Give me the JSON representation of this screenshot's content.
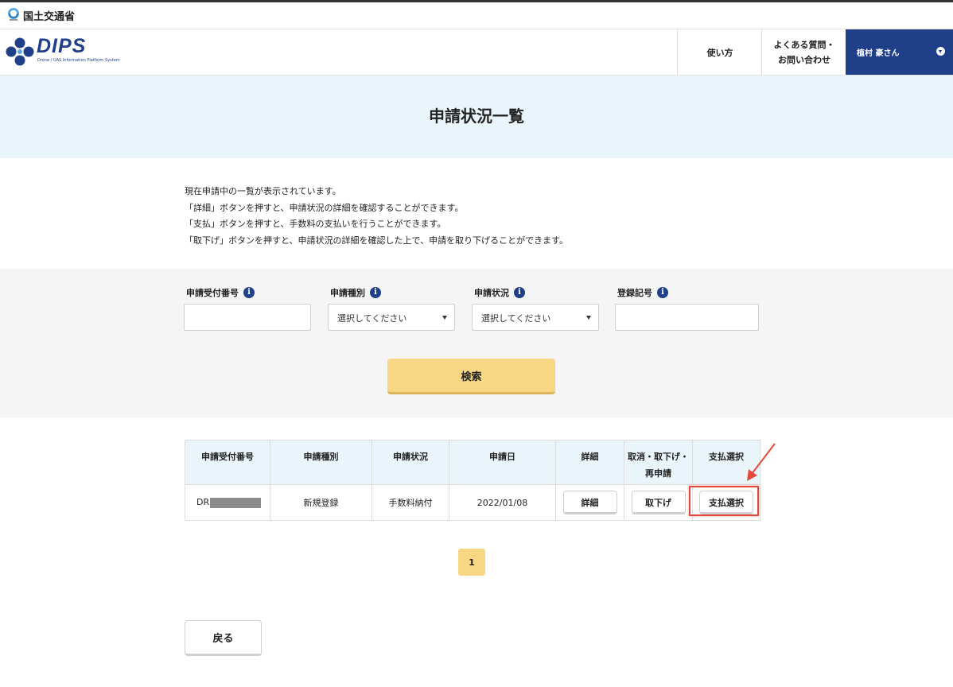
{
  "gov": {
    "ministry_name": "国土交通省"
  },
  "header": {
    "logo_text": "DIPS",
    "logo_subtitle": "Drone / UAS Information Platform System",
    "nav_usage": "使い方",
    "nav_faq_line1": "よくある質問・",
    "nav_faq_line2": "お問い合わせ",
    "user_name": "植村 豪さん",
    "brand_color": "#1f3f88"
  },
  "page": {
    "title": "申請状況一覧",
    "description": [
      "現在申請中の一覧が表示されています。",
      "「詳細」ボタンを押すと、申請状況の詳細を確認することができます。",
      "「支払」ボタンを押すと、手数料の支払いを行うことができます。",
      "「取下げ」ボタンを押すと、申請状況の詳細を確認した上で、申請を取り下げることができます。"
    ]
  },
  "search": {
    "fields": [
      {
        "label": "申請受付番号",
        "value": ""
      },
      {
        "label": "申請種別",
        "selected": "選択してください"
      },
      {
        "label": "申請状況",
        "selected": "選択してください"
      },
      {
        "label": "登録記号",
        "value": ""
      }
    ],
    "button_label": "検索",
    "button_color": "#f7d684"
  },
  "table": {
    "headers": [
      "申請受付番号",
      "申請種別",
      "申請状況",
      "申請日",
      "詳細",
      "取消・取下げ・再申請",
      "支払選択"
    ],
    "rows": [
      {
        "receipt_prefix": "DR",
        "type": "新規登録",
        "status": "手数料納付",
        "date": "2022/01/08",
        "detail_button": "詳細",
        "withdraw_button": "取下げ",
        "pay_button": "支払選択"
      }
    ]
  },
  "pagination": {
    "current_page": "1"
  },
  "footer": {
    "back_label": "戻る"
  },
  "annotation": {
    "highlight_color": "#e24a3b",
    "highlight_target": "支払選択"
  }
}
